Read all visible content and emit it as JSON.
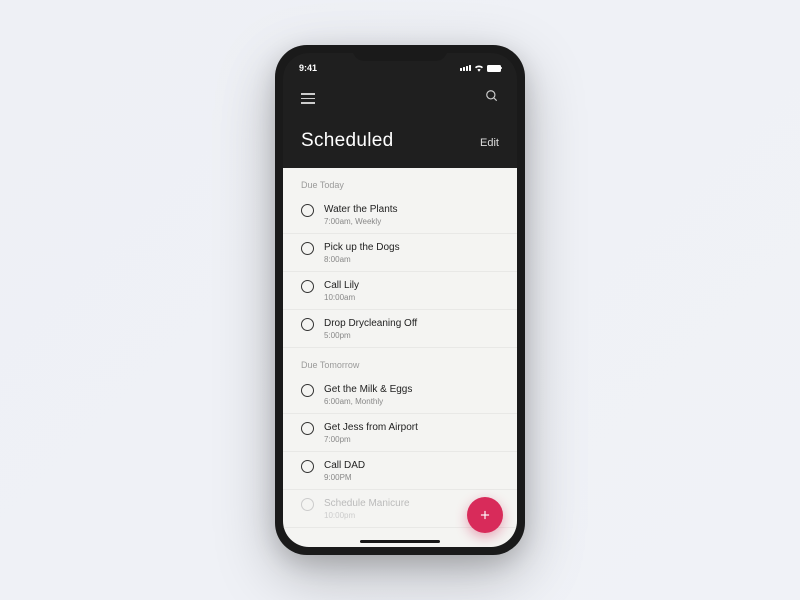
{
  "status": {
    "time": "9:41"
  },
  "header": {
    "title": "Scheduled",
    "edit": "Edit"
  },
  "sections": {
    "today": {
      "label": "Due Today",
      "tasks": [
        {
          "title": "Water the Plants",
          "time": "7:00am, Weekly"
        },
        {
          "title": "Pick up the Dogs",
          "time": "8:00am"
        },
        {
          "title": "Call Lily",
          "time": "10:00am"
        },
        {
          "title": "Drop Drycleaning Off",
          "time": "5:00pm"
        }
      ]
    },
    "tomorrow": {
      "label": "Due Tomorrow",
      "tasks": [
        {
          "title": "Get the Milk & Eggs",
          "time": "6:00am, Monthly"
        },
        {
          "title": "Get Jess from Airport",
          "time": "7:00pm"
        },
        {
          "title": "Call DAD",
          "time": "9:00PM"
        },
        {
          "title": "Schedule Manicure",
          "time": "10:00pm"
        }
      ]
    }
  },
  "colors": {
    "accent": "#d82b5a"
  }
}
